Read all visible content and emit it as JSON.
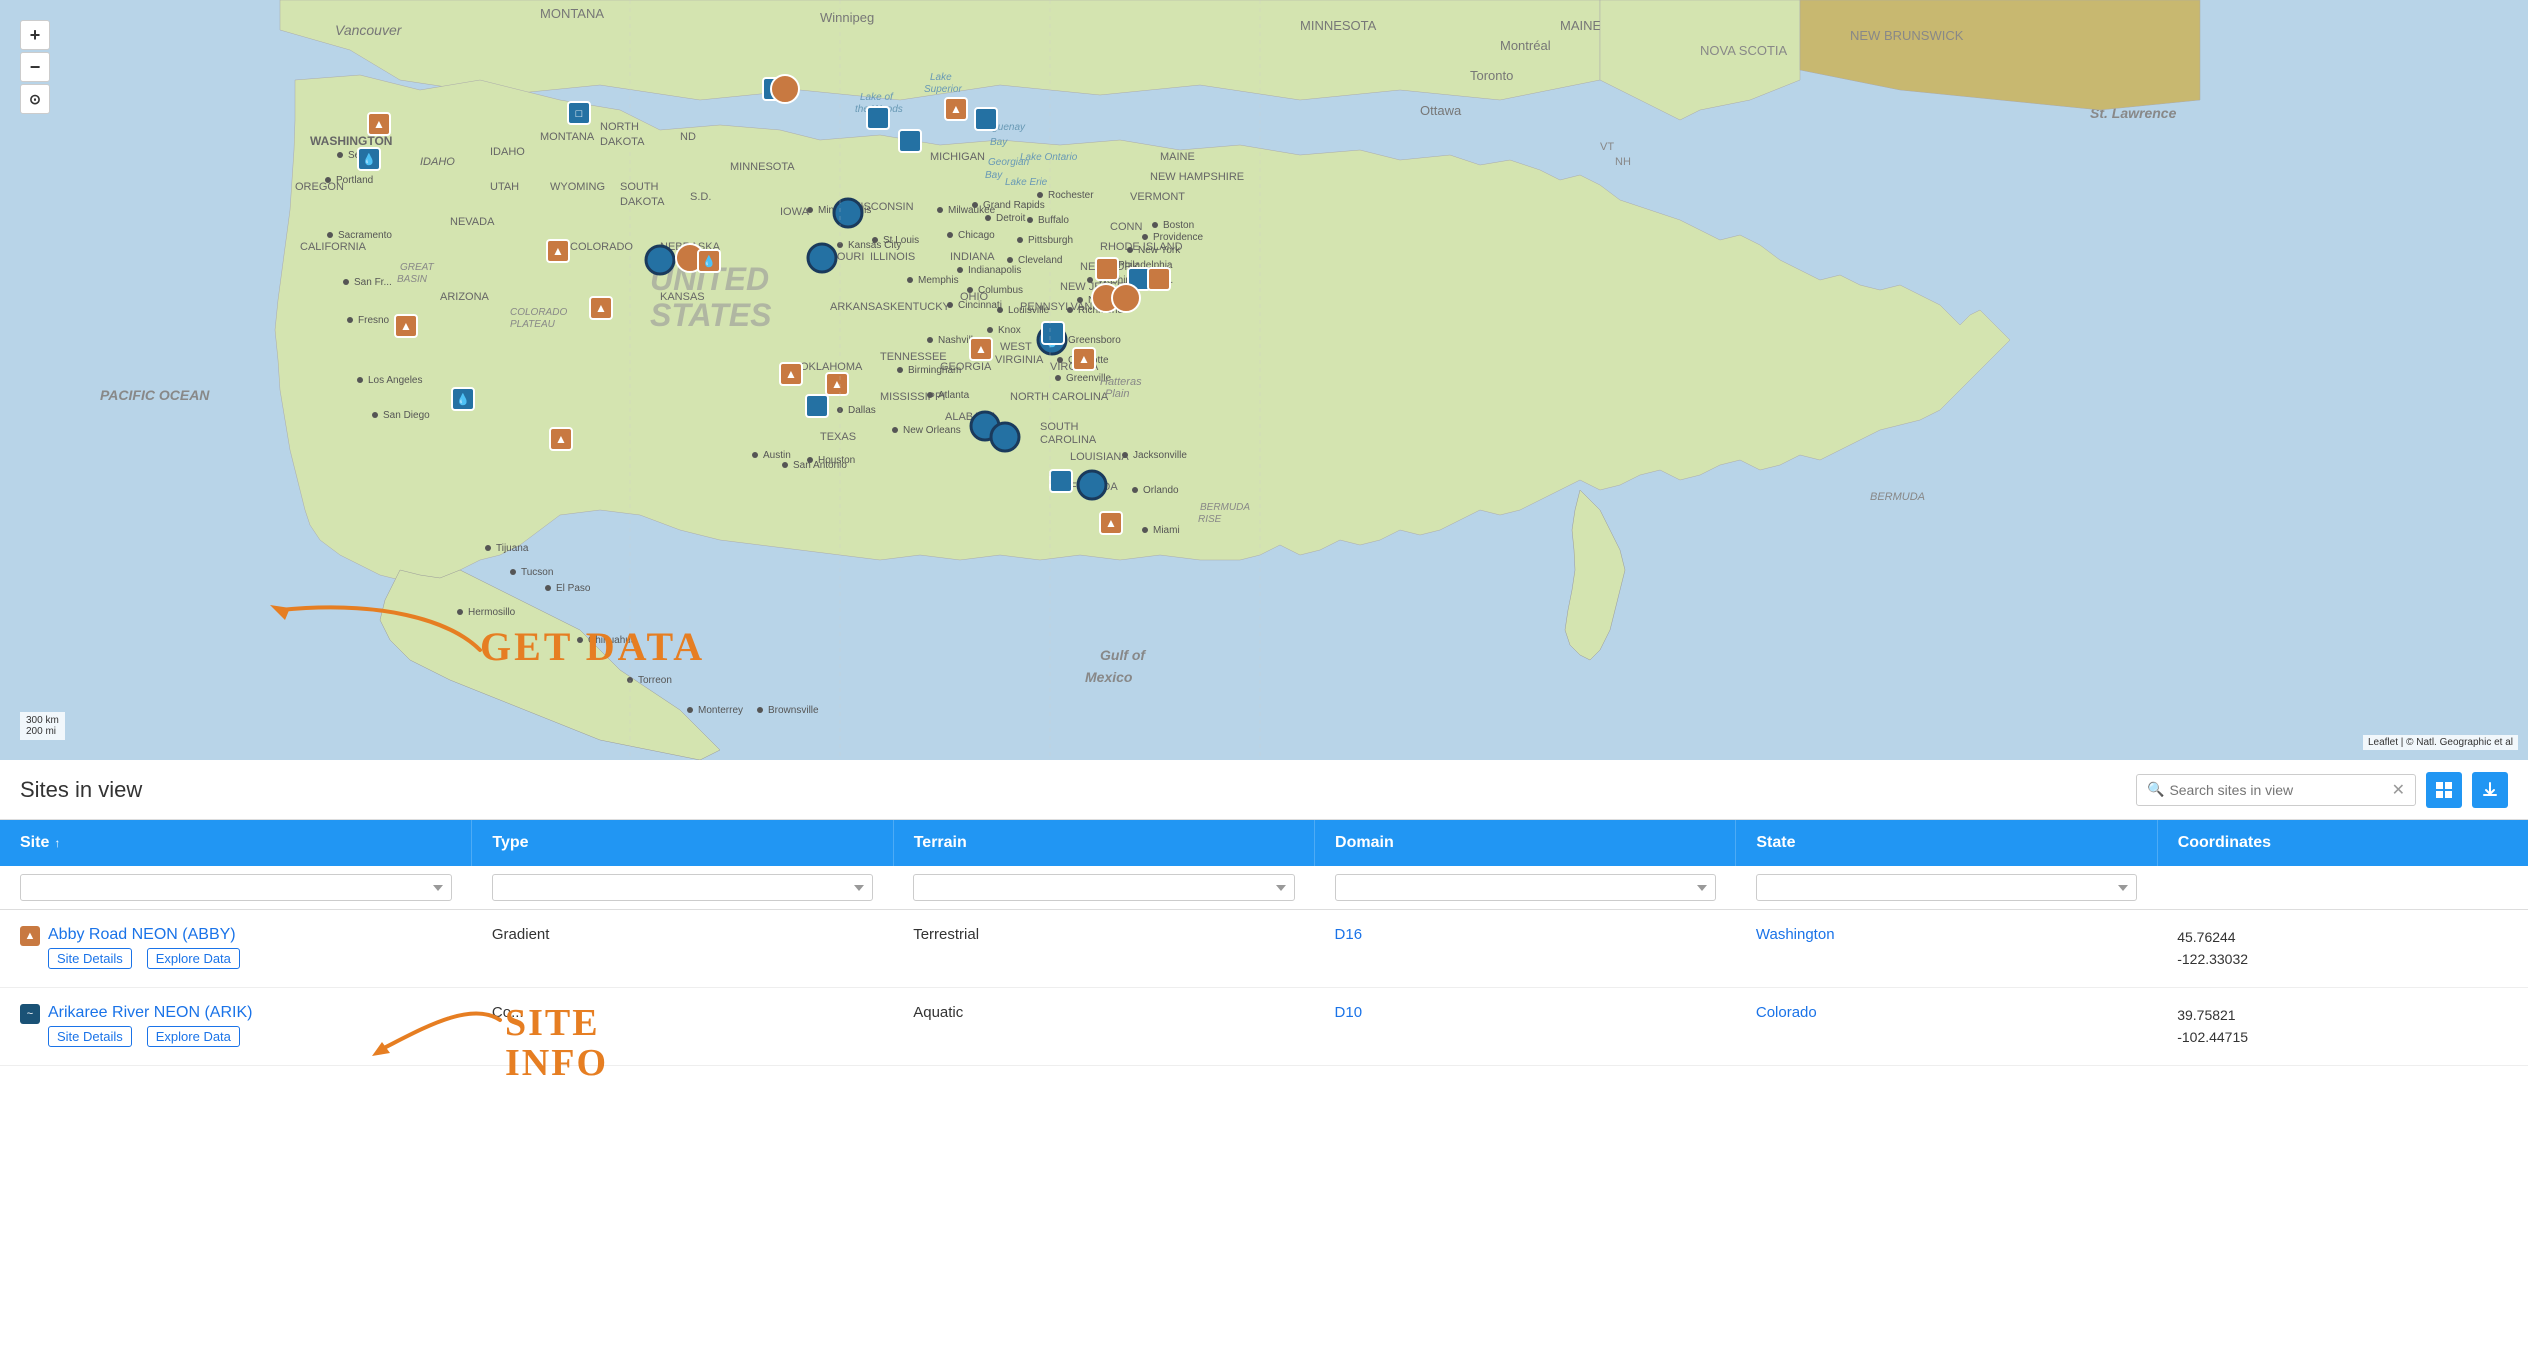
{
  "map": {
    "controls": {
      "zoom_in": "+",
      "zoom_out": "−",
      "locate": "⊙"
    },
    "scale": {
      "km": "300 km",
      "mi": "200 mi"
    },
    "attribution": "Leaflet | © Natl. Geographic et al"
  },
  "annotations": {
    "get_data": "GET DATA",
    "site_info": "SITE INFO"
  },
  "bottom_panel": {
    "title": "Sites in view",
    "search_placeholder": "Search sites in view",
    "columns": {
      "site": "Site",
      "type": "Type",
      "terrain": "Terrain",
      "domain": "Domain",
      "state": "State",
      "coordinates": "Coordinates"
    },
    "rows": [
      {
        "id": 1,
        "site_name": "Abby Road NEON (ABBY)",
        "site_details_label": "Site Details",
        "explore_data_label": "Explore Data",
        "type": "Gradient",
        "terrain": "Terrestrial",
        "domain": "D16",
        "state": "Washington",
        "lat": "45.76244",
        "lon": "-122.33032",
        "icon": "mountain"
      },
      {
        "id": 2,
        "site_name": "Arikaree River NEON (ARIK)",
        "site_details_label": "Site Details",
        "explore_data_label": "Explore Data",
        "type": "Co...",
        "terrain": "Aquatic",
        "domain": "D10",
        "state": "Colorado",
        "lat": "39.75821",
        "lon": "-102.44715",
        "icon": "water"
      }
    ]
  }
}
